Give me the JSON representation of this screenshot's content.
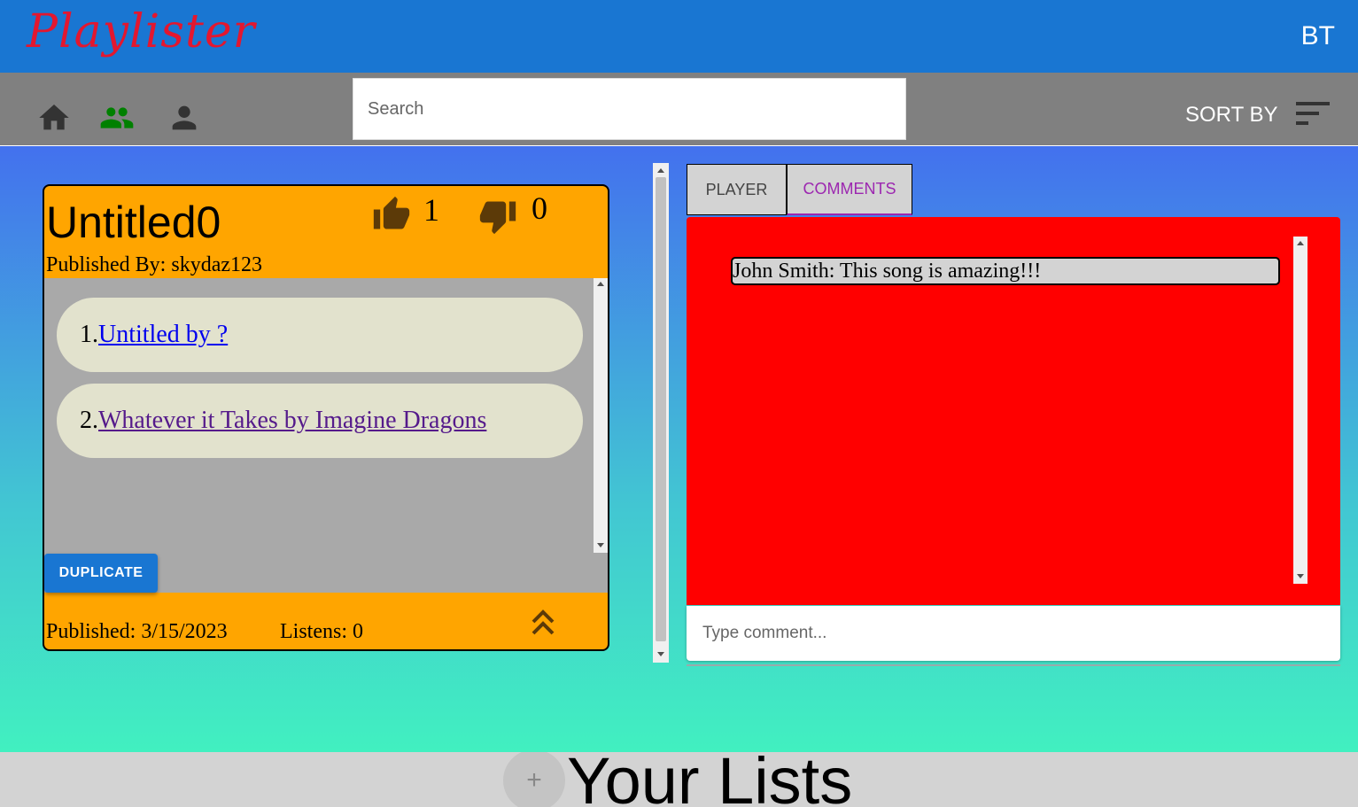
{
  "app": {
    "logo": "Playlister",
    "user_initials": "BT"
  },
  "toolbar": {
    "search_placeholder": "Search",
    "sort_label": "SORT BY",
    "icons": [
      "home-icon",
      "groups-icon",
      "person-icon",
      "sort-icon"
    ],
    "active_icon_color": "#008000"
  },
  "playlist": {
    "title": "Untitled0",
    "published_by": "Published By: skydaz123",
    "likes": "1",
    "dislikes": "0",
    "songs": [
      {
        "index": "1.",
        "label": "Untitled by ?"
      },
      {
        "index": "2.",
        "label": "Whatever it Takes by Imagine Dragons"
      }
    ],
    "duplicate_label": "DUPLICATE",
    "published_date": "Published: 3/15/2023",
    "listens": "Listens: 0"
  },
  "tabs": {
    "player": "PLAYER",
    "comments": "COMMENTS",
    "active": "comments"
  },
  "comments": {
    "items": [
      {
        "text": "John Smith: This song is amazing!!!"
      }
    ],
    "input_placeholder": "Type comment..."
  },
  "footer": {
    "add_label": "+",
    "title": "Your Lists"
  },
  "colors": {
    "topbar": "#1976d2",
    "card": "#ffa500",
    "comments_panel": "#ff0000",
    "logo": "#e3172f"
  }
}
